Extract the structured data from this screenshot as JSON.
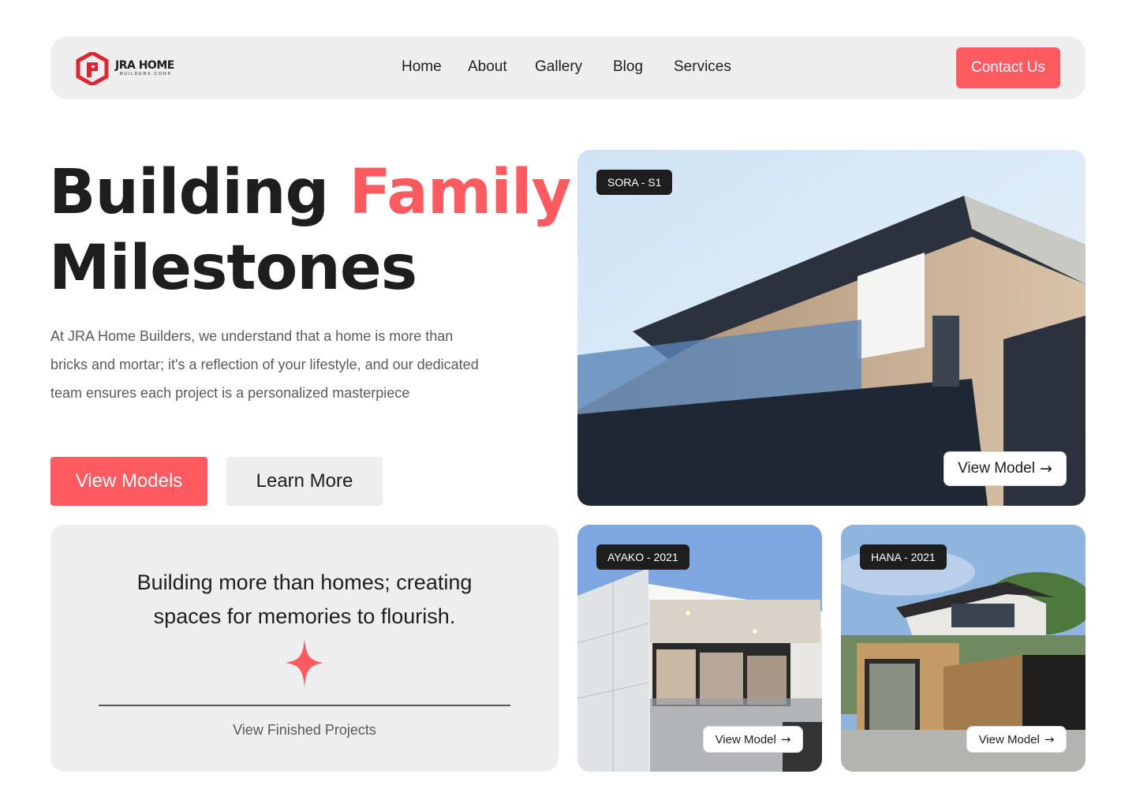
{
  "brand": {
    "name": "JRA HOME",
    "tagline": "BUILDERS CORP.",
    "accent_color": "#ff5a5f"
  },
  "nav": {
    "links": [
      "Home",
      "About",
      "Gallery",
      "Blog",
      "Services"
    ],
    "contact_label": "Contact Us"
  },
  "hero": {
    "title_part1": "Building",
    "title_accent": "Family",
    "title_part2": "Milestones",
    "description": "At JRA Home Builders, we understand that a home is more than bricks and mortar; it's a reflection of your lifestyle, and our dedicated team ensures each project is a personalized masterpiece",
    "primary_button": "View Models",
    "secondary_button": "Learn More"
  },
  "panel": {
    "quote": "Building more than homes; creating spaces for memories to flourish.",
    "link_label": "View Finished Projects",
    "icon": "sparkle-icon"
  },
  "models": [
    {
      "tag": "SORA - S1",
      "button": "View Model"
    },
    {
      "tag": "AYAKO - 2021",
      "button": "View Model"
    },
    {
      "tag": "HANA - 2021",
      "button": "View Model"
    }
  ],
  "icons": {
    "arrow": "→"
  }
}
